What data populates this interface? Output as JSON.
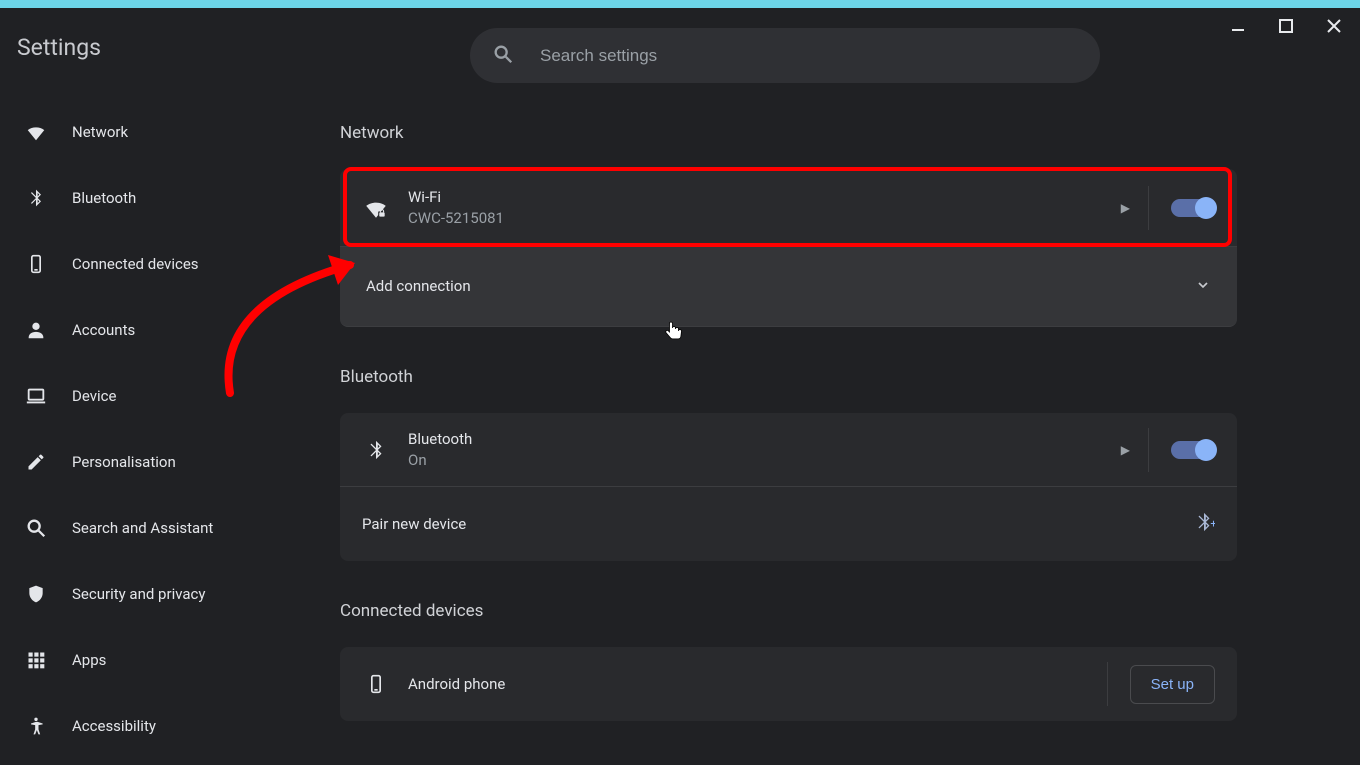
{
  "sidebar": {
    "title": "Settings",
    "items": [
      {
        "label": "Network"
      },
      {
        "label": "Bluetooth"
      },
      {
        "label": "Connected devices"
      },
      {
        "label": "Accounts"
      },
      {
        "label": "Device"
      },
      {
        "label": "Personalisation"
      },
      {
        "label": "Search and Assistant"
      },
      {
        "label": "Security and privacy"
      },
      {
        "label": "Apps"
      },
      {
        "label": "Accessibility"
      }
    ]
  },
  "search": {
    "placeholder": "Search settings"
  },
  "sections": {
    "network": {
      "heading": "Network",
      "wifi": {
        "title": "Wi-Fi",
        "ssid": "CWC-5215081",
        "on": true
      },
      "add_connection": "Add connection"
    },
    "bluetooth": {
      "heading": "Bluetooth",
      "title": "Bluetooth",
      "status": "On",
      "on": true,
      "pair": "Pair new device"
    },
    "connected_devices": {
      "heading": "Connected devices",
      "phone": {
        "title": "Android phone",
        "setup": "Set up"
      }
    }
  }
}
